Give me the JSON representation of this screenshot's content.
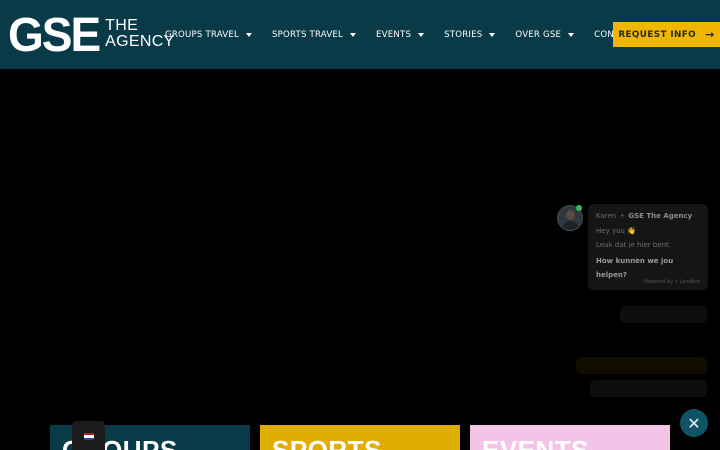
{
  "brand": {
    "mark": "GSE",
    "line1": "THE",
    "line2": "AGENCY"
  },
  "nav": [
    {
      "label": "GROUPS TRAVEL",
      "dropdown": true
    },
    {
      "label": "SPORTS TRAVEL",
      "dropdown": true
    },
    {
      "label": "EVENTS",
      "dropdown": true
    },
    {
      "label": "STORIES",
      "dropdown": true
    },
    {
      "label": "OVER GSE",
      "dropdown": true
    },
    {
      "label": "CONTACT",
      "dropdown": false
    }
  ],
  "cta": {
    "label": "REQUEST INFO",
    "icon": "arrow-right-icon"
  },
  "chat": {
    "agent": "Karen",
    "separator": "•",
    "company": "GSE The Agency",
    "line1": "Hey you 👋",
    "line2": "Leuk dat je hier bent.",
    "question": "How kunnen we jou helpen?",
    "powered": "Powered by ⚡ Landbot"
  },
  "cards": [
    {
      "title": "GROUPS"
    },
    {
      "title": "SPORTS"
    },
    {
      "title": "EVENTS"
    }
  ],
  "colors": {
    "header": "#083a48",
    "accent": "#f2b600",
    "sports": "#e0ad00",
    "events": "#f3c4e8",
    "chat_close": "#0e5466"
  }
}
